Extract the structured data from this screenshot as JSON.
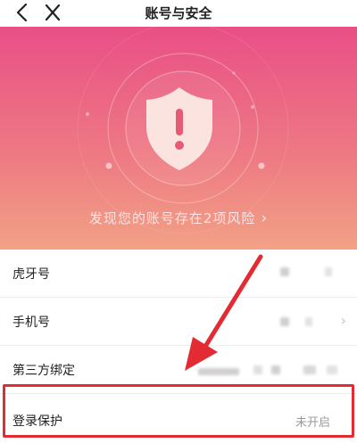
{
  "header": {
    "title": "账号与安全",
    "back_icon": "chevron-left-icon",
    "close_icon": "close-icon"
  },
  "hero": {
    "risk_text": "发现您的账号存在2项风险",
    "risk_chevron": "›",
    "gradient_top": "#e94f86",
    "gradient_bottom": "#f2a286",
    "shield_icon": "shield-alert-icon"
  },
  "settings": {
    "items": [
      {
        "label": "虎牙号",
        "value": ""
      },
      {
        "label": "手机号",
        "value": "",
        "arrow": "›"
      },
      {
        "label": "第三方绑定",
        "value": ""
      },
      {
        "label": "登录保护",
        "value": "未开启"
      }
    ]
  },
  "annotation": {
    "highlight_color": "#e32b34"
  }
}
